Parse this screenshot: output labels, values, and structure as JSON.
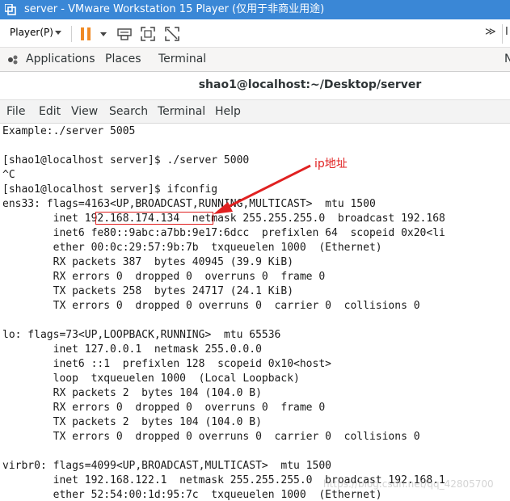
{
  "window": {
    "title": "server - VMware Workstation 15 Player (仅用于非商业用途)"
  },
  "toolbar": {
    "player_label": "Player(P)",
    "more_label": "≫",
    "cut_label": "I",
    "pause_color": "#f08a24"
  },
  "gnome": {
    "applications": "Applications",
    "places": "Places",
    "terminal": "Terminal",
    "cut_label": "N"
  },
  "terminal_window": {
    "title": "shao1@localhost:~/Desktop/server"
  },
  "menu": [
    "File",
    "Edit",
    "View",
    "Search",
    "Terminal",
    "Help"
  ],
  "lines": [
    "Example:./server 5005",
    "",
    "[shao1@localhost server]$ ./server 5000",
    "^C",
    "[shao1@localhost server]$ ifconfig",
    "ens33: flags=4163<UP,BROADCAST,RUNNING,MULTICAST>  mtu 1500",
    "        inet 192.168.174.134  netmask 255.255.255.0  broadcast 192.168",
    "        inet6 fe80::9abc:a7bb:9e17:6dcc  prefixlen 64  scopeid 0x20<li",
    "        ether 00:0c:29:57:9b:7b  txqueuelen 1000  (Ethernet)",
    "        RX packets 387  bytes 40945 (39.9 KiB)",
    "        RX errors 0  dropped 0  overruns 0  frame 0",
    "        TX packets 258  bytes 24717 (24.1 KiB)",
    "        TX errors 0  dropped 0 overruns 0  carrier 0  collisions 0",
    "",
    "lo: flags=73<UP,LOOPBACK,RUNNING>  mtu 65536",
    "        inet 127.0.0.1  netmask 255.0.0.0",
    "        inet6 ::1  prefixlen 128  scopeid 0x10<host>",
    "        loop  txqueuelen 1000  (Local Loopback)",
    "        RX packets 2  bytes 104 (104.0 B)",
    "        RX errors 0  dropped 0  overruns 0  frame 0",
    "        TX packets 2  bytes 104 (104.0 B)",
    "        TX errors 0  dropped 0 overruns 0  carrier 0  collisions 0",
    "",
    "virbr0: flags=4099<UP,BROADCAST,MULTICAST>  mtu 1500",
    "        inet 192.168.122.1  netmask 255.255.255.0  broadcast 192.168.1",
    "        ether 52:54:00:1d:95:7c  txqueuelen 1000  (Ethernet)"
  ],
  "annotation": {
    "label": "ip地址",
    "color": "#e02020"
  },
  "watermark": "https://blog.csdn.net/qq_42805700"
}
